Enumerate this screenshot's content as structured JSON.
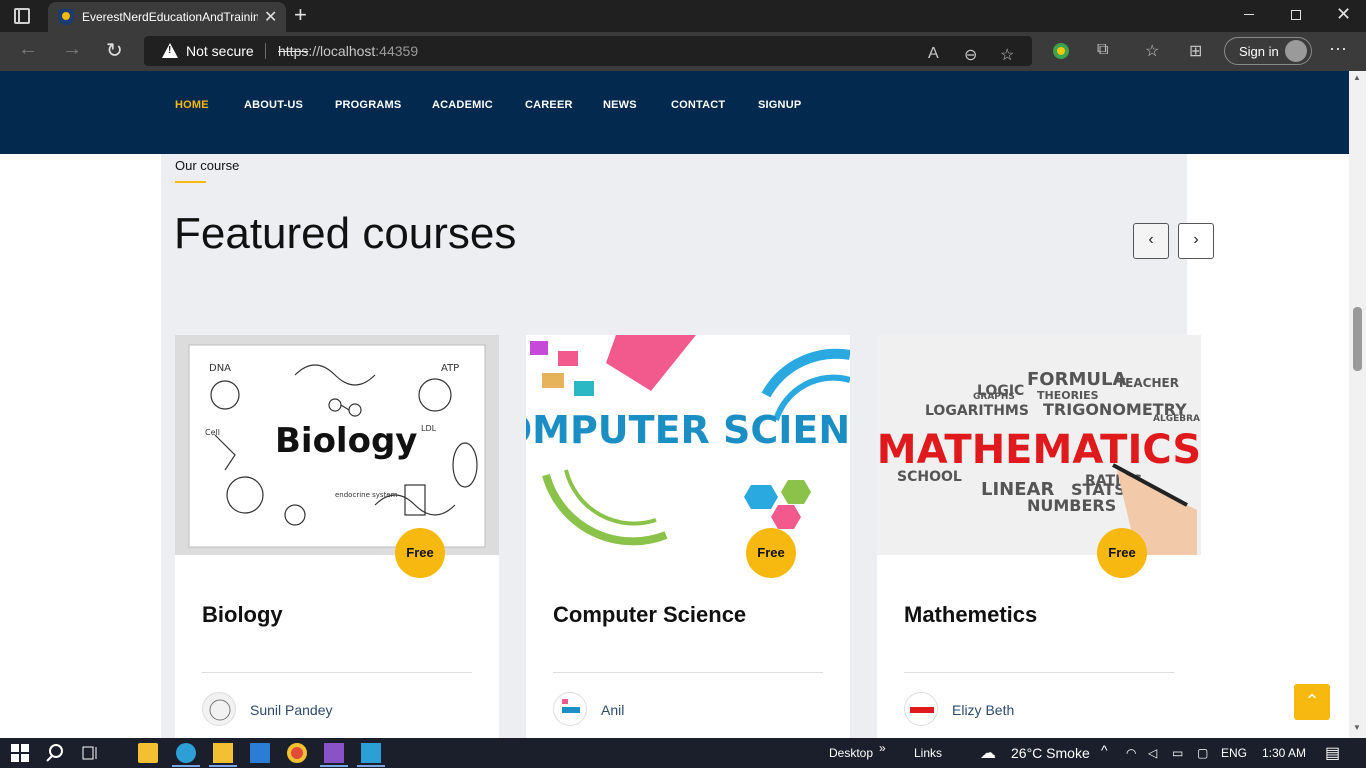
{
  "browser": {
    "tab_title": "EverestNerdEducationAndTraining",
    "security_label": "Not secure",
    "url_scheme": "https",
    "url_host": "://localhost",
    "url_port": ":44359",
    "signin_label": "Sign in"
  },
  "site": {
    "nav": [
      "HOME",
      "ABOUT-US",
      "PROGRAMS",
      "ACADEMIC",
      "CAREER",
      "NEWS",
      "CONTACT",
      "SIGNUP"
    ],
    "active_nav": "HOME",
    "eyebrow": "Our course",
    "section_title": "Featured courses",
    "courses": [
      {
        "image_caption": "Biology",
        "price": "Free",
        "title": "Biology",
        "author": "Sunil Pandey"
      },
      {
        "image_caption": "COMPUTER SCIENCE",
        "price": "Free",
        "title": "Computer Science",
        "author": "Anil"
      },
      {
        "image_caption": "MATHEMATICS",
        "price": "Free",
        "title": "Mathemetics",
        "author": "Elizy Beth"
      }
    ],
    "math_words": [
      "LOGIC",
      "FORMULA",
      "GRAPHS",
      "THEORIES",
      "TEACHER",
      "LOGARITHMS",
      "TRIGONOMETRY",
      "ALGEBRA",
      "SCHOOL",
      "NUMBERS",
      "STATS",
      "RATIOS",
      "LINEAR"
    ],
    "bio_words": [
      "DNA",
      "ATP",
      "Cell",
      "LDL",
      "endocrine system"
    ]
  },
  "taskbar": {
    "desktop_label": "Desktop",
    "links_label": "Links",
    "weather": "26°C  Smoke",
    "language": "ENG",
    "time": "1:30 AM"
  },
  "colors": {
    "nav_bg": "#04294f",
    "accent": "#f7b90f",
    "section_bg": "#eceef1"
  }
}
